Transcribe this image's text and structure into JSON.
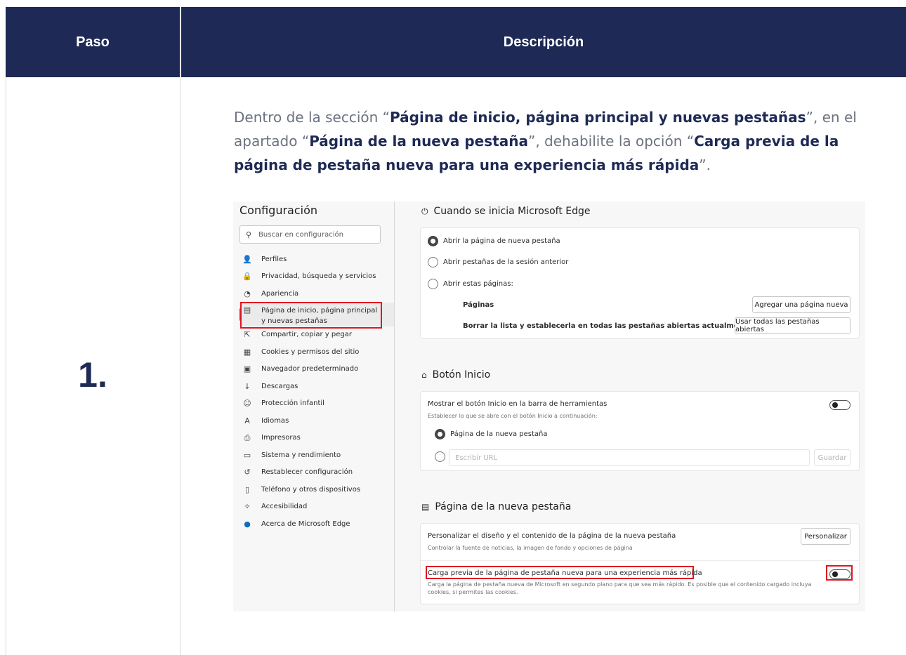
{
  "table": {
    "col_paso": "Paso",
    "col_descripcion": "Descripción",
    "step_number": "1."
  },
  "instruction": {
    "t1": "Dentro de la sección “",
    "b1": "Página de inicio, página principal y nuevas pestañas",
    "t2": "”, en el apartado “",
    "b2": "Página de la nueva pestaña",
    "t3": "”, dehabilite la opción “",
    "b3": "Carga previa de la página de pestaña nueva para una experiencia más rápida",
    "t4": "”."
  },
  "sidebar": {
    "title": "Configuración",
    "search_placeholder": "Buscar en configuración",
    "items": [
      {
        "label": "Perfiles",
        "icon": "profile-icon",
        "glyph": "👤"
      },
      {
        "label": "Privacidad, búsqueda y servicios",
        "icon": "lock-icon",
        "glyph": "🔒"
      },
      {
        "label": "Apariencia",
        "icon": "palette-icon",
        "glyph": "◔"
      },
      {
        "label": "Página de inicio, página principal y nuevas pestañas",
        "icon": "home-tab-icon",
        "glyph": "▤"
      },
      {
        "label": "Compartir, copiar y pegar",
        "icon": "share-icon",
        "glyph": "⇱"
      },
      {
        "label": "Cookies y permisos del sitio",
        "icon": "cookies-icon",
        "glyph": "▦"
      },
      {
        "label": "Navegador predeterminado",
        "icon": "browser-icon",
        "glyph": "▣"
      },
      {
        "label": "Descargas",
        "icon": "download-icon",
        "glyph": "↓"
      },
      {
        "label": "Protección infantil",
        "icon": "family-icon",
        "glyph": "☺"
      },
      {
        "label": "Idiomas",
        "icon": "language-icon",
        "glyph": "A"
      },
      {
        "label": "Impresoras",
        "icon": "printer-icon",
        "glyph": "⎙"
      },
      {
        "label": "Sistema y rendimiento",
        "icon": "laptop-icon",
        "glyph": "▭"
      },
      {
        "label": "Restablecer configuración",
        "icon": "reset-icon",
        "glyph": "↺"
      },
      {
        "label": "Teléfono y otros dispositivos",
        "icon": "phone-icon",
        "glyph": "▯"
      },
      {
        "label": "Accesibilidad",
        "icon": "accessibility-icon",
        "glyph": "✧"
      },
      {
        "label": "Acerca de Microsoft Edge",
        "icon": "edge-icon",
        "glyph": "●"
      }
    ]
  },
  "startup": {
    "title": "Cuando se inicia Microsoft Edge",
    "opt1": "Abrir la página de nueva pestaña",
    "opt2": "Abrir pestañas de la sesión anterior",
    "opt3": "Abrir estas páginas:",
    "pages_label": "Páginas",
    "add_page_button": "Agregar una página nueva",
    "clear_label": "Borrar la lista y establecerla en todas las pestañas abiertas actualmente",
    "use_all_button": "Usar todas las pestañas abiertas"
  },
  "home_button": {
    "title": "Botón Inicio",
    "show_label": "Mostrar el botón Inicio en la barra de herramientas",
    "sub_label": "Establecer lo que se abre con el botón Inicio a continuación:",
    "opt_new_tab": "Página de la nueva pestaña",
    "url_placeholder": "Escribir URL",
    "save_button": "Guardar"
  },
  "new_tab": {
    "title": "Página de la nueva pestaña",
    "customize_label": "Personalizar el diseño y el contenido de la página de la nueva pestaña",
    "customize_sub": "Controlar la fuente de noticias, la imagen de fondo y opciones de página",
    "customize_button": "Personalizar",
    "preload_label": "Carga previa de la página de pestaña nueva para una experiencia más rápida",
    "preload_sub1": "Carga la página de pestaña nueva de Microsoft en segundo plano para que sea más rápido. Es posible que el contenido cargado incluya",
    "preload_sub2": "cookies, si permites las cookies."
  },
  "colors": {
    "header_bg": "#1e2a55",
    "highlight": "#e0161f",
    "edge_accent": "#0f6cbd"
  }
}
